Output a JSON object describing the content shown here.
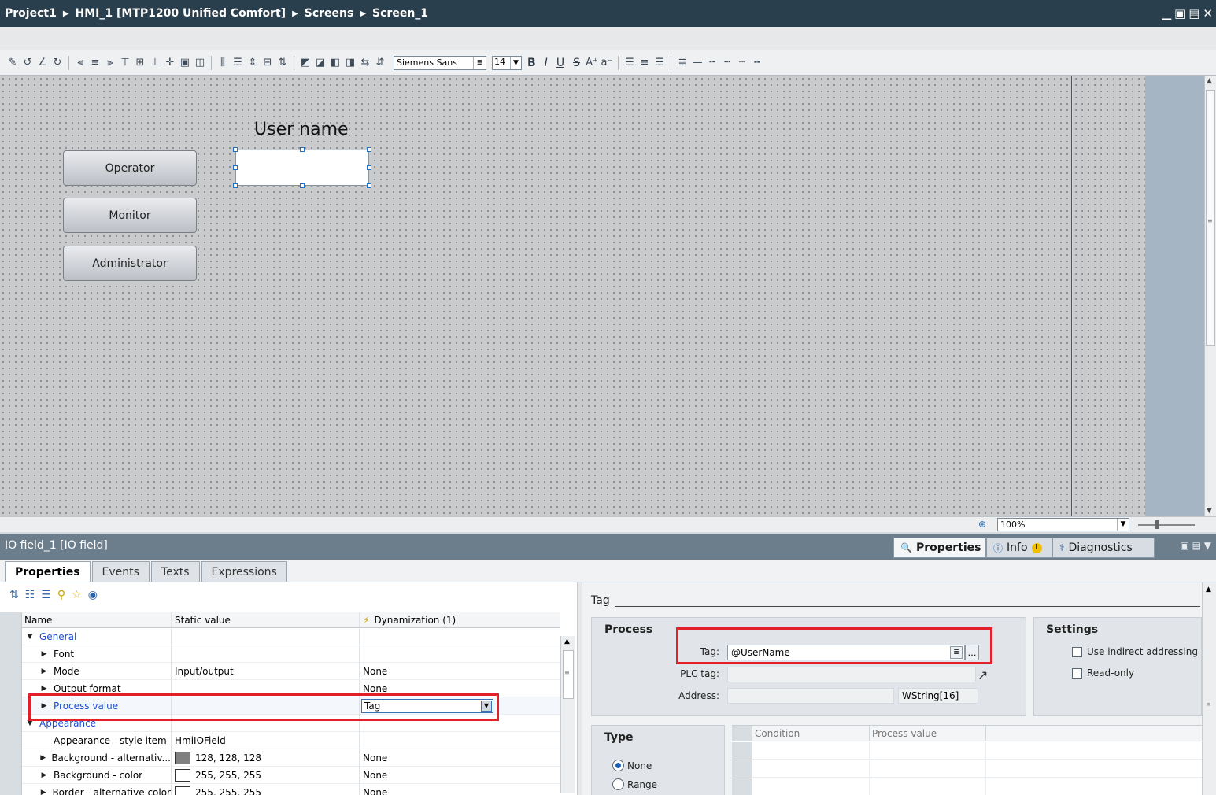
{
  "titlebar": {
    "crumbs": [
      "Project1",
      "HMI_1 [MTP1200 Unified Comfort]",
      "Screens",
      "Screen_1"
    ]
  },
  "toolbar": {
    "font_name": "Siemens Sans",
    "font_size": "14",
    "bold": "B",
    "italic": "I",
    "underline": "U",
    "strike": "S"
  },
  "canvas": {
    "label_username": "User name",
    "buttons": [
      "Operator",
      "Monitor",
      "Administrator"
    ]
  },
  "zoom": {
    "value": "100%"
  },
  "inspector": {
    "title": "IO field_1 [IO field]",
    "tabs": {
      "properties": "Properties",
      "info": "Info",
      "diagnostics": "Diagnostics"
    },
    "subtabs": [
      "Properties",
      "Events",
      "Texts",
      "Expressions"
    ],
    "grid": {
      "headers": {
        "name": "Name",
        "static": "Static value",
        "dyn": "Dynamization (1)"
      },
      "rows": [
        {
          "name": "General",
          "static": "",
          "dyn": ""
        },
        {
          "name": "Font",
          "static": "",
          "dyn": ""
        },
        {
          "name": "Mode",
          "static": "Input/output",
          "dyn": "None"
        },
        {
          "name": "Output format",
          "static": "",
          "dyn": "None"
        },
        {
          "name": "Process value",
          "static": "",
          "dyn": "Tag"
        },
        {
          "name": "Appearance",
          "static": "",
          "dyn": ""
        },
        {
          "name": "Appearance - style item",
          "static": "HmiIOField",
          "dyn": ""
        },
        {
          "name": "Background - alternativ...",
          "static": "128, 128, 128",
          "dyn": "None"
        },
        {
          "name": "Background - color",
          "static": "255, 255, 255",
          "dyn": "None"
        },
        {
          "name": "Border - alternative color",
          "static": "255, 255, 255",
          "dyn": "None"
        }
      ]
    },
    "tag_section": {
      "heading": "Tag",
      "process": {
        "title": "Process",
        "tag_label": "Tag:",
        "tag_value": "@UserName",
        "plc_label": "PLC tag:",
        "address_label": "Address:",
        "datatype": "WString[16]"
      },
      "settings": {
        "title": "Settings",
        "indirect": "Use indirect addressing",
        "readonly": "Read-only"
      },
      "type": {
        "title": "Type",
        "none": "None",
        "range": "Range"
      },
      "condition_table": {
        "condition": "Condition",
        "process_value": "Process value"
      }
    }
  },
  "colors": {
    "titlebar": "#2a3f4e",
    "highlight_red": "#e3202a",
    "link_blue": "#1a4fd0",
    "swatch_grey": "#808080",
    "swatch_white": "#ffffff"
  }
}
